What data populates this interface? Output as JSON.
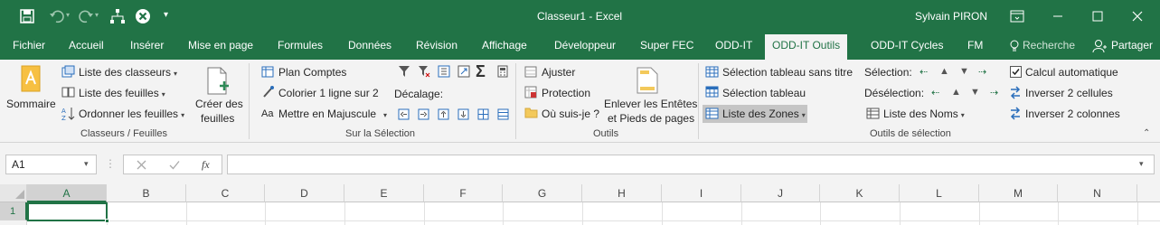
{
  "window": {
    "title": "Classeur1 - Excel",
    "user": "Sylvain PIRON"
  },
  "tabs": {
    "file": "Fichier",
    "home": "Accueil",
    "insert": "Insérer",
    "layout": "Mise en page",
    "formulas": "Formules",
    "data": "Données",
    "review": "Révision",
    "view": "Affichage",
    "developer": "Développeur",
    "superfec": "Super FEC",
    "oddit": "ODD-IT",
    "odditools": "ODD-IT Outils",
    "odditcycles": "ODD-IT Cycles",
    "fm": "FM",
    "search": "Recherche",
    "share": "Partager"
  },
  "ribbon": {
    "g1": {
      "summary": "Sommaire",
      "list_workbooks": "Liste des classeurs",
      "list_sheets": "Liste des feuilles",
      "sort_sheets": "Ordonner les feuilles",
      "create_sheets_1": "Créer des",
      "create_sheets_2": "feuilles",
      "label": "Classeurs / Feuilles"
    },
    "g2": {
      "plan": "Plan Comptes",
      "color_rows": "Colorier 1 ligne sur 2",
      "uppercase": "Mettre en Majuscule",
      "shift": "Décalage:",
      "label": "Sur la Sélection"
    },
    "g3": {
      "adjust": "Ajuster",
      "protect": "Protection",
      "where": "Où suis-je ?",
      "headers_1": "Enlever les Entêtes",
      "headers_2": "et Pieds de pages",
      "label": "Outils"
    },
    "g4": {
      "table_untitled": "Sélection tableau sans titre",
      "table": "Sélection tableau",
      "zones": "Liste des Zones",
      "names": "Liste des Noms",
      "selection": "Sélection:",
      "deselection": "Désélection:",
      "autocalc": "Calcul automatique",
      "invert_cells": "Inverser 2 cellules",
      "invert_cols": "Inverser 2 colonnes",
      "label": "Outils de sélection"
    }
  },
  "formula_bar": {
    "name_box": "A1",
    "fx": "fx",
    "value": ""
  },
  "grid": {
    "columns": [
      "A",
      "B",
      "C",
      "D",
      "E",
      "F",
      "G",
      "H",
      "I",
      "J",
      "K",
      "L",
      "M",
      "N"
    ],
    "rows": [
      "1"
    ]
  }
}
